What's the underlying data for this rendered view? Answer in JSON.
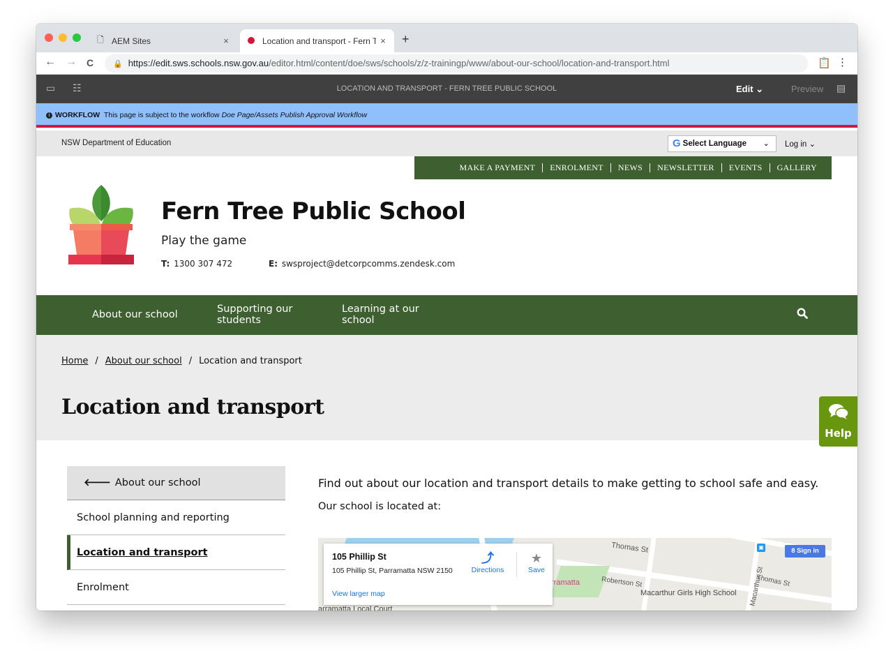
{
  "browser": {
    "tabs": [
      {
        "title": "AEM Sites",
        "close": "×"
      },
      {
        "title": "Location and transport - Fern T",
        "close": "×"
      }
    ],
    "new_tab": "+",
    "url_host": "https://edit.sws.schools.nsw.gov.au",
    "url_path": "/editor.html/content/doe/sws/schools/z/z-trainingp/www/about-our-school/location-and-transport.html",
    "nav": {
      "back": "←",
      "forward": "→",
      "reload": "C"
    },
    "menu": "⋮"
  },
  "aem": {
    "page_title": "LOCATION AND TRANSPORT - FERN TREE PUBLIC SCHOOL",
    "edit_label": "Edit",
    "edit_caret": "⌄",
    "preview_label": "Preview"
  },
  "workflow": {
    "label": "WORKFLOW",
    "text": "This page is subject to the workflow",
    "name": "Doe Page/Assets Publish Approval Workflow"
  },
  "site": {
    "department": "NSW Department of Education",
    "language_select": "Select Language",
    "login": "Log in",
    "quick_links": [
      "MAKE A PAYMENT",
      "ENROLMENT",
      "NEWS",
      "NEWSLETTER",
      "EVENTS",
      "GALLERY"
    ],
    "school_name": "Fern Tree Public School",
    "motto": "Play the game",
    "phone_label": "T:",
    "phone": "1300 307 472",
    "email_label": "E:",
    "email": "swsproject@detcorpcomms.zendesk.com",
    "main_nav": [
      "About our school",
      "Supporting our students",
      "Learning at our school"
    ],
    "breadcrumb": [
      "Home",
      "About our school",
      "Location and transport"
    ],
    "breadcrumb_sep": "/",
    "page_title": "Location and transport",
    "help_label": "Help",
    "side_nav": {
      "back": "About our school",
      "items": [
        "School planning and reporting",
        "Location and transport",
        "Enrolment"
      ],
      "active_index": 1
    },
    "intro": "Find out about our location and transport details to make getting to school safe and easy.",
    "located": "Our school is located at:",
    "map": {
      "address_title": "105 Phillip St",
      "address_full": "105 Phillip St, Parramatta NSW 2150",
      "directions": "Directions",
      "save": "Save",
      "view_larger": "View larger map",
      "sign_in": "Sign in",
      "labels": [
        "Thomas St",
        "Robertson St",
        "Macarthur Girls High School",
        "Macarthur St",
        "Thomas St",
        "rramatta",
        "arramatta Local Court"
      ]
    }
  },
  "colors": {
    "nav_green": "#3e5f2f",
    "help_green": "#69960f",
    "workflow_blue": "#8fc0fb",
    "nsw_red": "#d7153a"
  }
}
